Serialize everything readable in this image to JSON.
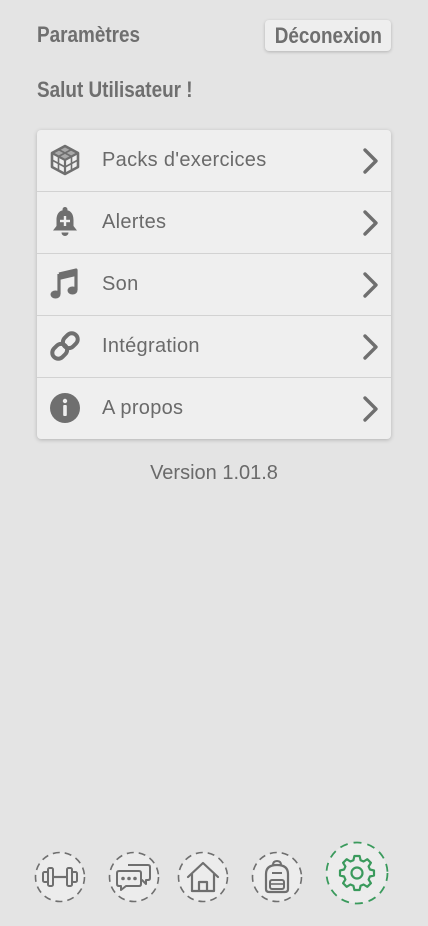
{
  "header": {
    "title": "Paramètres",
    "logout_label": "Déconexion"
  },
  "greeting": "Salut Utilisateur !",
  "menu": {
    "items": [
      {
        "label": "Packs d'exercices",
        "icon": "cube-icon"
      },
      {
        "label": "Alertes",
        "icon": "bell-plus-icon"
      },
      {
        "label": "Son",
        "icon": "music-note-icon"
      },
      {
        "label": "Intégration",
        "icon": "link-icon"
      },
      {
        "label": "A propos",
        "icon": "info-icon"
      }
    ]
  },
  "version": "Version 1.01.8",
  "bottom_nav": {
    "items": [
      {
        "icon": "dumbbell-icon",
        "active": false
      },
      {
        "icon": "chat-icon",
        "active": false
      },
      {
        "icon": "home-icon",
        "active": false
      },
      {
        "icon": "backpack-icon",
        "active": false
      },
      {
        "icon": "gear-icon",
        "active": true
      }
    ],
    "active_color": "#3a9a5c",
    "inactive_color": "#6f6f6f"
  },
  "colors": {
    "background": "#e4e4e4",
    "card": "#efefef",
    "text": "#6a6a6a"
  }
}
